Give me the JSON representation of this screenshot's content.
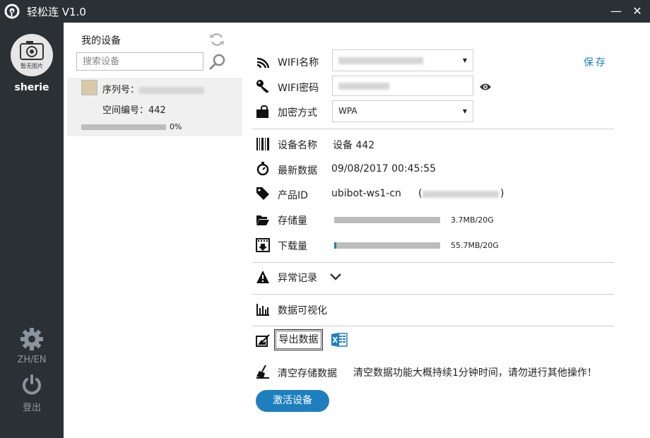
{
  "window": {
    "title": "轻松连 V1.0",
    "minimize": "—",
    "close": "✕"
  },
  "sidebar": {
    "avatar_caption": "暂无图片",
    "username": "sherie",
    "lang": "ZH/EN",
    "logout": "登出"
  },
  "devices": {
    "title": "我的设备",
    "search_placeholder": "搜索设备",
    "items": [
      {
        "serial_label": "序列号：",
        "space_label": "空间编号：442",
        "progress": 0,
        "progress_text": "0%"
      }
    ]
  },
  "wifi": {
    "name_label": "WIFI名称",
    "password_label": "WIFI密码",
    "encryption_label": "加密方式",
    "encryption_value": "WPA",
    "save": "保存"
  },
  "info": {
    "device_name_label": "设备名称",
    "device_name_value": "设备 442",
    "latest_label": "最新数据",
    "latest_value": "09/08/2017 00:45:55",
    "product_label": "产品ID",
    "product_value": "ubibot-ws1-cn",
    "product_paren_open": "(",
    "product_paren_close": ")",
    "storage_label": "存储量",
    "storage_text": "3.7MB/20G",
    "storage_fraction": 0.0,
    "download_label": "下载量",
    "download_text": "55.7MB/20G",
    "download_fraction": 0.02
  },
  "sections": {
    "alerts": "异常记录",
    "visualize": "数据可视化",
    "export": "导出数据",
    "clear": "清空存储数据",
    "clear_warning": "清空数据功能大概持续1分钟时间，请勿进行其他操作！",
    "activate": "激活设备"
  },
  "colors": {
    "accent": "#1e7fbf",
    "sidebar": "#2b3035"
  }
}
